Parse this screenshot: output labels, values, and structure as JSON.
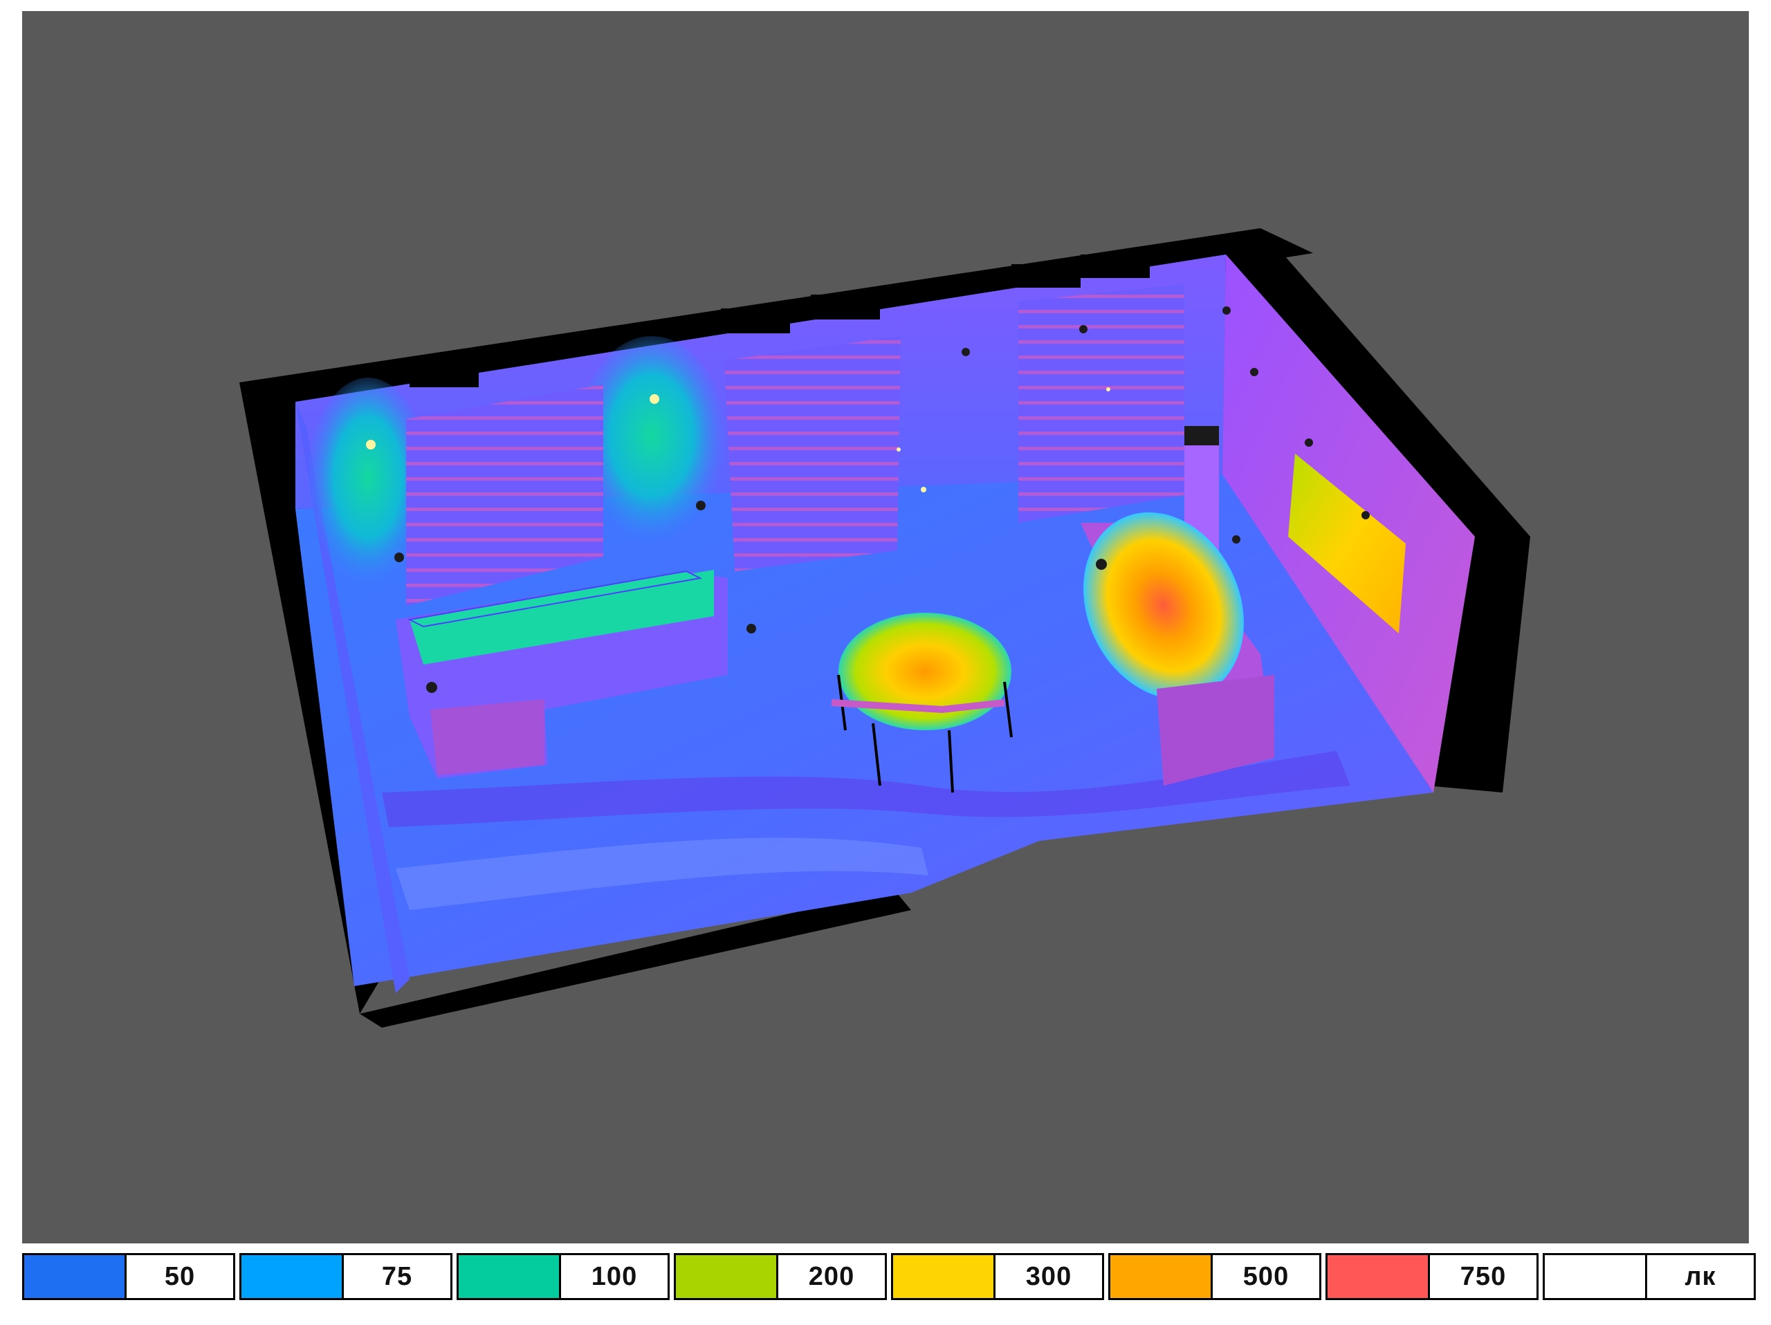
{
  "legend": {
    "items": [
      {
        "color": "#1e6ff2",
        "label": "50"
      },
      {
        "color": "#00a2ff",
        "label": "75"
      },
      {
        "color": "#05cc9e",
        "label": "100"
      },
      {
        "color": "#a8d400",
        "label": "200"
      },
      {
        "color": "#ffd500",
        "label": "300"
      },
      {
        "color": "#ffa600",
        "label": "500"
      },
      {
        "color": "#ff5656",
        "label": "750"
      },
      {
        "color": "#ffffff",
        "label": "лк"
      }
    ]
  },
  "colors": {
    "background": "#595959",
    "walls": "#000000",
    "floor_base": "#4a6cff",
    "wall_base": "#8a55ff"
  }
}
